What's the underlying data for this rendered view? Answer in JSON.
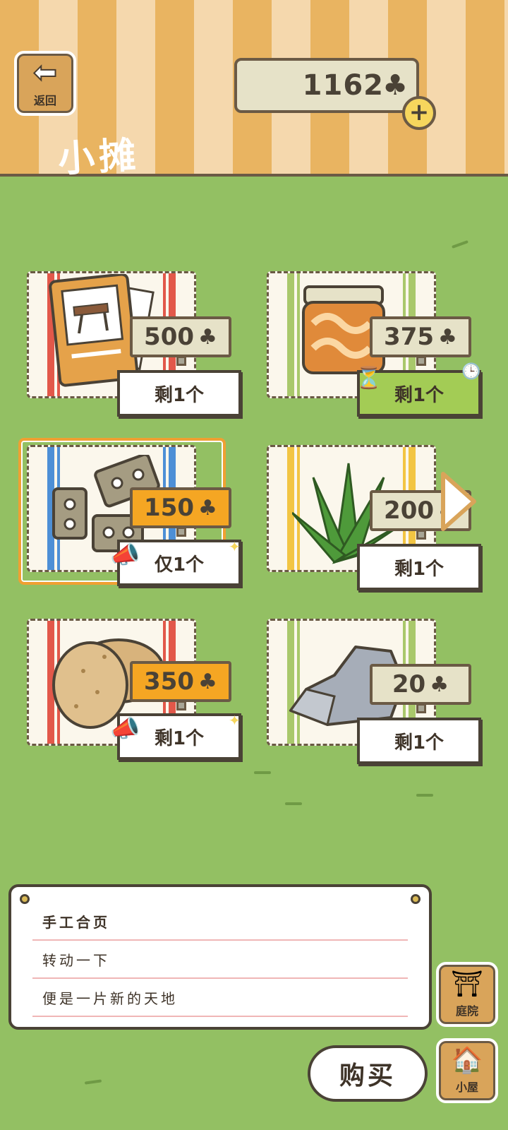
{
  "header": {
    "back_label": "返回",
    "coins": "1162",
    "title": "小摊"
  },
  "items": [
    {
      "name": "stool-blueprint",
      "price": "500",
      "stock": "剩1个",
      "sale": false,
      "timed": false,
      "stripe_color": "#e2584a"
    },
    {
      "name": "jam-jar",
      "price": "375",
      "stock": "剩1个",
      "sale": false,
      "timed": true,
      "stripe_color": "#a9c86b"
    },
    {
      "name": "hinges",
      "price": "150",
      "stock": "仅1个",
      "sale": true,
      "timed": false,
      "stripe_color": "#4d8fd6",
      "selected": true
    },
    {
      "name": "palm-leaf",
      "price": "200",
      "stock": "剩1个",
      "sale": false,
      "timed": false,
      "stripe_color": "#f2c543"
    },
    {
      "name": "rice-crackers",
      "price": "350",
      "stock": "剩1个",
      "sale": true,
      "timed": false,
      "stripe_color": "#e2584a"
    },
    {
      "name": "stone",
      "price": "20",
      "stock": "剩1个",
      "sale": false,
      "timed": false,
      "stripe_color": "#a9c86b"
    }
  ],
  "description": {
    "line1": "手工合页",
    "line2": "转动一下",
    "line3": "便是一片新的天地"
  },
  "side": {
    "yard_label": "庭院",
    "house_label": "小屋"
  },
  "buy_label": "购买"
}
